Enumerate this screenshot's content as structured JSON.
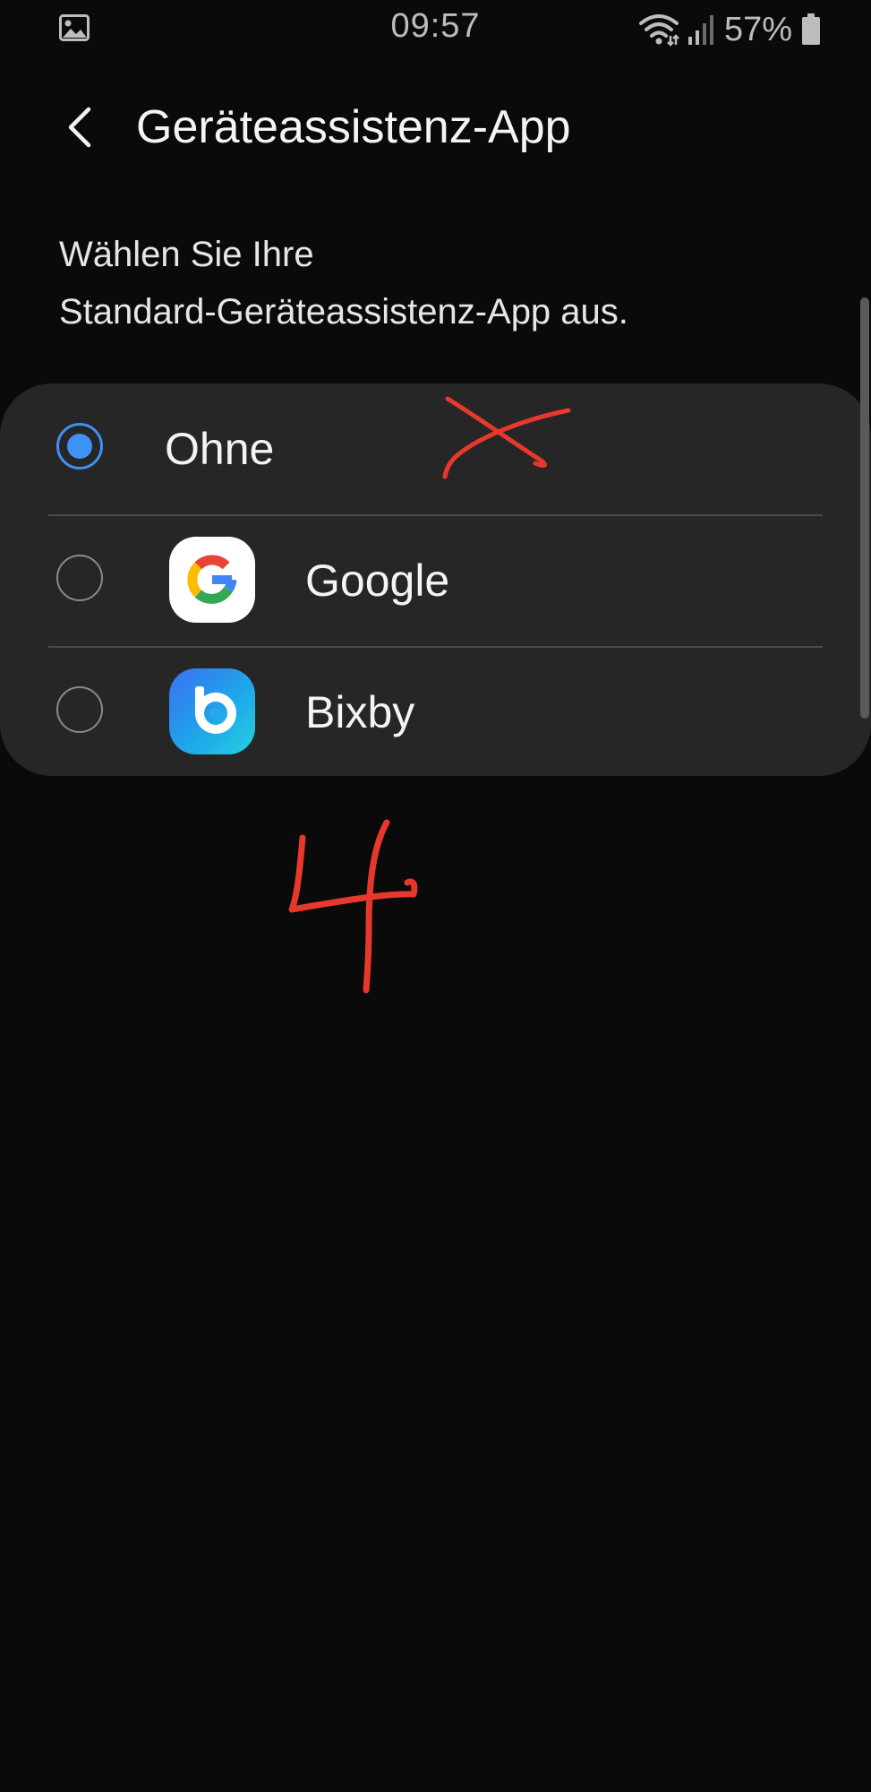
{
  "status_bar": {
    "time": "09:57",
    "battery_percent": "57%",
    "icons": [
      "gallery-icon",
      "wifi-icon",
      "signal-icon",
      "battery-icon"
    ]
  },
  "app_bar": {
    "back_icon": "chevron-left-icon",
    "title": "Geräteassistenz-App"
  },
  "description": {
    "line1": "Wählen Sie Ihre",
    "line2": "Standard-Geräteassistenz-App aus."
  },
  "options": [
    {
      "label": "Ohne",
      "selected": true,
      "icon": null
    },
    {
      "label": "Google",
      "selected": false,
      "icon": "google-icon"
    },
    {
      "label": "Bixby",
      "selected": false,
      "icon": "bixby-icon"
    }
  ],
  "annotations": {
    "marks": [
      "cross-mark",
      "digit-four-mark"
    ],
    "color": "#e8382e"
  },
  "colors": {
    "background": "#0a0a0a",
    "card": "#262626",
    "accent": "#3e91f5"
  }
}
